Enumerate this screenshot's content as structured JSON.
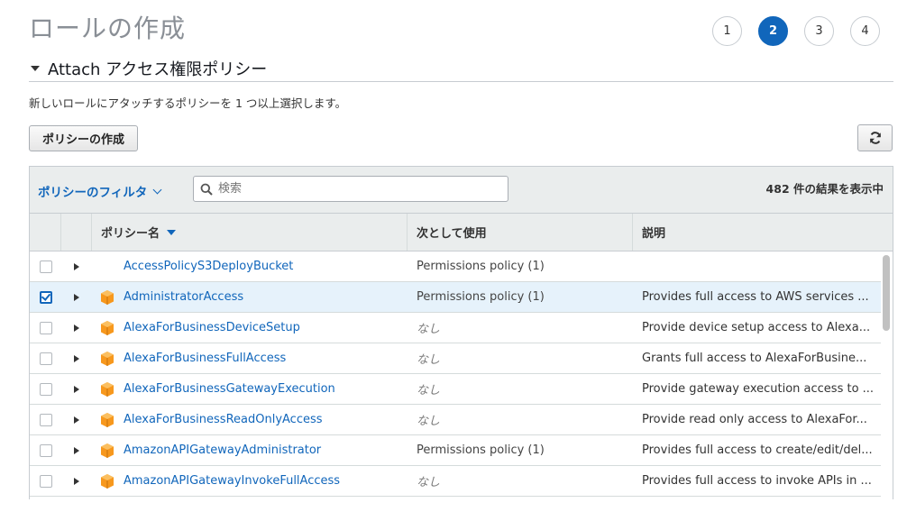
{
  "page": {
    "title": "ロールの作成"
  },
  "steps": [
    "1",
    "2",
    "3",
    "4"
  ],
  "section": {
    "title": "Attach アクセス権限ポリシー"
  },
  "description": "新しいロールにアタッチするポリシーを 1 つ以上選択します。",
  "toolbar": {
    "create_policy_label": "ポリシーの作成",
    "refresh_icon": "refresh-icon"
  },
  "filter": {
    "dropdown_label": "ポリシーのフィルタ",
    "search_placeholder": "検索",
    "result_count": "482 件の結果を表示中"
  },
  "columns": {
    "name": "ポリシー名",
    "used_as": "次として使用",
    "description": "説明"
  },
  "rows": [
    {
      "name": "AccessPolicyS3DeployBucket",
      "used_as": "Permissions policy (1)",
      "description": "",
      "checked": false,
      "aws_managed": false
    },
    {
      "name": "AdministratorAccess",
      "used_as": "Permissions policy (1)",
      "description": "Provides full access to AWS services ...",
      "checked": true,
      "aws_managed": true
    },
    {
      "name": "AlexaForBusinessDeviceSetup",
      "used_as": "なし",
      "description": "Provide device setup access to Alexa...",
      "checked": false,
      "aws_managed": true
    },
    {
      "name": "AlexaForBusinessFullAccess",
      "used_as": "なし",
      "description": "Grants full access to AlexaForBusine...",
      "checked": false,
      "aws_managed": true
    },
    {
      "name": "AlexaForBusinessGatewayExecution",
      "used_as": "なし",
      "description": "Provide gateway execution access to ...",
      "checked": false,
      "aws_managed": true
    },
    {
      "name": "AlexaForBusinessReadOnlyAccess",
      "used_as": "なし",
      "description": "Provide read only access to AlexaFor...",
      "checked": false,
      "aws_managed": true
    },
    {
      "name": "AmazonAPIGatewayAdministrator",
      "used_as": "Permissions policy (1)",
      "description": "Provides full access to create/edit/del...",
      "checked": false,
      "aws_managed": true
    },
    {
      "name": "AmazonAPIGatewayInvokeFullAccess",
      "used_as": "なし",
      "description": "Provides full access to invoke APIs in ...",
      "checked": false,
      "aws_managed": true
    }
  ],
  "colors": {
    "accent": "#1166bb",
    "aws_icon": "#f7981d",
    "selected_row": "#e6f2fb"
  }
}
